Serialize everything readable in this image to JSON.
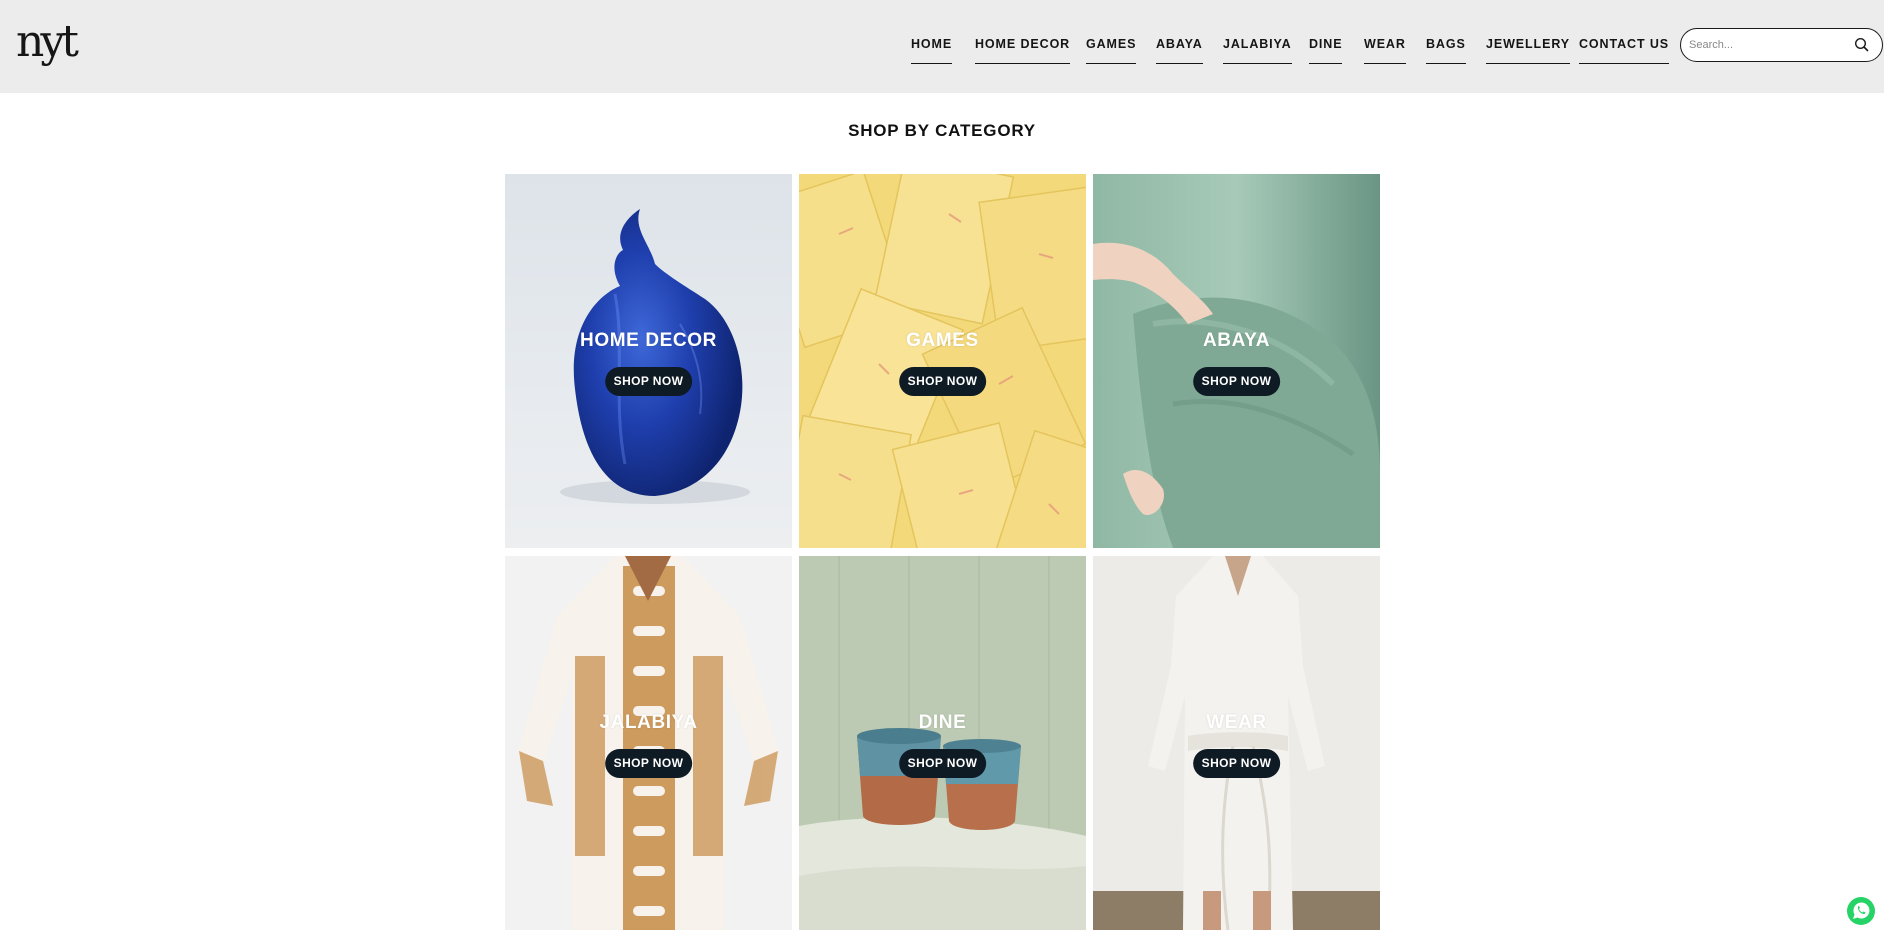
{
  "header": {
    "logo_text": "nyt",
    "nav": [
      "HOME",
      "HOME DECOR",
      "GAMES",
      "ABAYA",
      "JALABIYA",
      "DINE",
      "WEAR",
      "BAGS",
      "JEWELLERY",
      "CONTACT US"
    ],
    "search_placeholder": "Search..."
  },
  "main": {
    "section_title": "SHOP BY CATEGORY",
    "categories": [
      {
        "label": "HOME DECOR",
        "button": "SHOP NOW"
      },
      {
        "label": "GAMES",
        "button": "SHOP NOW"
      },
      {
        "label": "ABAYA",
        "button": "SHOP NOW"
      },
      {
        "label": "JALABIYA",
        "button": "SHOP NOW"
      },
      {
        "label": "DINE",
        "button": "SHOP NOW"
      },
      {
        "label": "WEAR",
        "button": "SHOP NOW"
      }
    ]
  },
  "colors": {
    "header_bg": "#ececec",
    "button_bg": "#0e1a24",
    "whatsapp": "#25d366"
  },
  "icons": [
    "search-icon",
    "whatsapp-icon"
  ]
}
